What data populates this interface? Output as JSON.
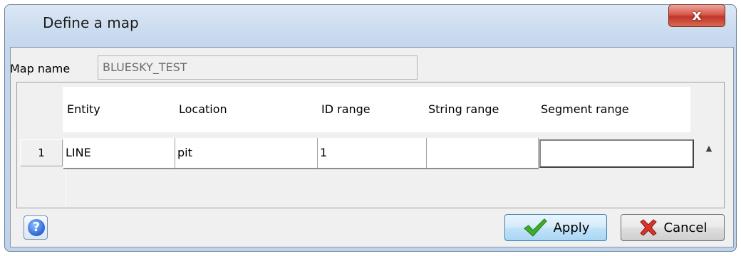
{
  "window": {
    "title": "Define a map",
    "close_icon": "x"
  },
  "form": {
    "map_name_label": "Map name",
    "map_name_value": "BLUESKY_TEST"
  },
  "table": {
    "columns": [
      "Entity",
      "Location",
      "ID range",
      "String range",
      "Segment range"
    ],
    "rows": [
      {
        "index": "1",
        "cells": [
          "LINE",
          "pit",
          "1",
          "",
          ""
        ]
      }
    ],
    "scroll_up_glyph": "▲"
  },
  "footer": {
    "help_glyph": "?",
    "apply_label": "Apply",
    "cancel_label": "Cancel"
  },
  "colors": {
    "title_bar": "#c9dbef",
    "close_button": "#c2352a",
    "apply_button": "#bfe2f8",
    "check_green": "#3fae2a",
    "cancel_x_red": "#d9342a"
  }
}
